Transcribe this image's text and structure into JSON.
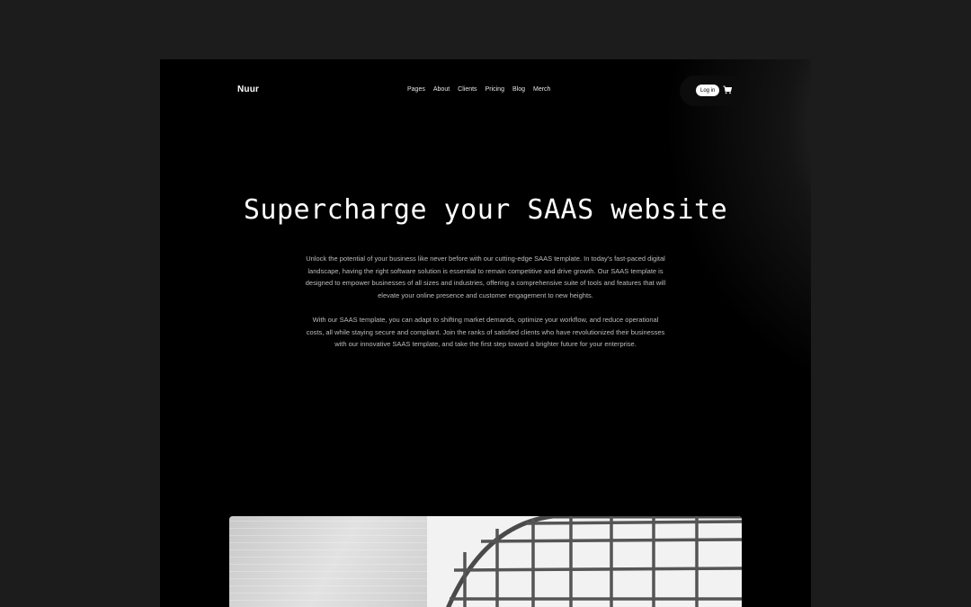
{
  "nav": {
    "brand": "Nuur",
    "links": [
      "Pages",
      "About",
      "Clients",
      "Pricing",
      "Blog",
      "Merch"
    ],
    "login_label": "Log in",
    "cart_icon": "cart-icon"
  },
  "hero": {
    "title": "Supercharge your SAAS website",
    "paragraph1": "Unlock the potential of your business like never before with our cutting-edge SAAS template. In today's fast-paced digital landscape, having the right software solution is essential to remain competitive and drive growth. Our SAAS template is designed to empower businesses of all sizes and industries, offering a comprehensive suite of tools and features that will elevate your online presence and customer engagement to new heights.",
    "paragraph2": "With our SAAS template, you can adapt to shifting market demands, optimize your workflow, and reduce operational costs, all while staying secure and compliant. Join the ranks of satisfied clients who have revolutionized their businesses with our innovative SAAS template, and take the first step toward a brighter future for your enterprise."
  },
  "colors": {
    "page_background": "#1c1c1c",
    "frame_background": "#000000",
    "text_primary": "#ffffff",
    "text_secondary": "#bdbdbd"
  }
}
